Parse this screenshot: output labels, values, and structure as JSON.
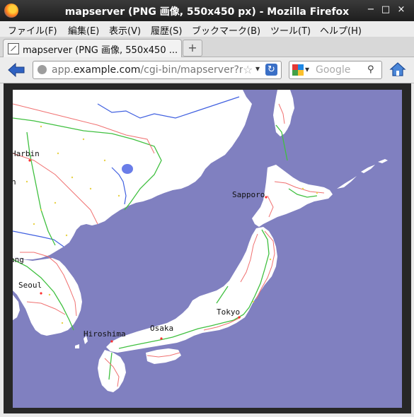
{
  "window": {
    "title": "mapserver (PNG 画像, 550x450 px) - Mozilla Firefox",
    "controls": {
      "minimize": "−",
      "maximize": "□",
      "close": "×"
    }
  },
  "menu": [
    "ファイル(F)",
    "編集(E)",
    "表示(V)",
    "履歴(S)",
    "ブックマーク(B)",
    "ツール(T)",
    "ヘルプ(H)"
  ],
  "tab": {
    "label": "mapserver (PNG 画像, 550x450 ...",
    "new_tab": "+"
  },
  "address": {
    "prefix": "app.",
    "domain": "example.com",
    "path": "/cgi-bin/mapserver?ma",
    "icons": {
      "bookmark": "star-icon",
      "dropdown": "chevron-down-icon",
      "reload": "reload-icon"
    }
  },
  "search": {
    "placeholder": "Google",
    "engine_icon": "google-icon",
    "icon": "binoculars-icon"
  },
  "map": {
    "labels": [
      "Harbin",
      "Sapporo",
      "Seoul",
      "Tokyo",
      "Osaka",
      "Hiroshima"
    ],
    "partial_labels": [
      "n",
      "ang"
    ],
    "colors": {
      "sea": "#8080c0",
      "land": "#ffffff",
      "roads": "#f07070",
      "rail": "#40c040",
      "border": "#4060e0",
      "lake": "#6a7de8"
    }
  }
}
